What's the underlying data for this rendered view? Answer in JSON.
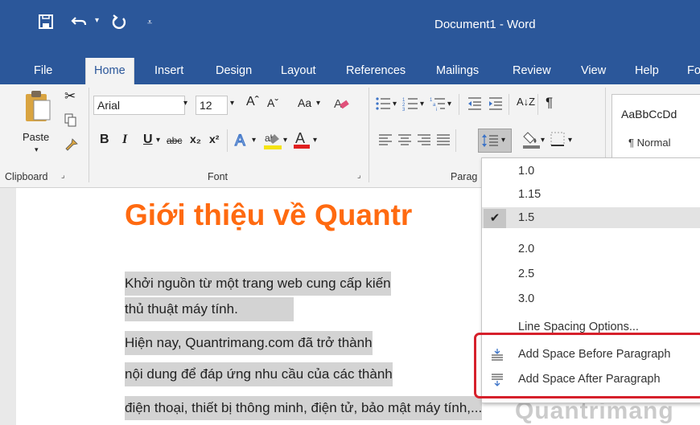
{
  "window": {
    "title": "Document1  -  Word"
  },
  "titlebar_icons": {
    "save": "save-icon",
    "undo": "undo-icon",
    "redo": "redo-icon",
    "customize": "customize-qat-icon"
  },
  "tabs": [
    {
      "label": "File"
    },
    {
      "label": "Home"
    },
    {
      "label": "Insert"
    },
    {
      "label": "Design"
    },
    {
      "label": "Layout"
    },
    {
      "label": "References"
    },
    {
      "label": "Mailings"
    },
    {
      "label": "Review"
    },
    {
      "label": "View"
    },
    {
      "label": "Help"
    },
    {
      "label": "Fo"
    }
  ],
  "ribbon": {
    "clipboard": {
      "paste_label": "Paste",
      "group_label": "Clipboard"
    },
    "font": {
      "name": "Arial",
      "size": "12",
      "group_label": "Font",
      "bold": "B",
      "italic": "I",
      "underline": "U",
      "strike": "abc",
      "subscript": "x₂",
      "superscript": "x²",
      "grow": "Aˆ",
      "shrink": "Aˇ",
      "case": "Aa",
      "font_color": "A",
      "highlight": "ab"
    },
    "paragraph": {
      "group_label": "Parag",
      "sort": "A↓Z",
      "pilcrow": "¶"
    },
    "styles": {
      "preview": "AaBbCcDd",
      "name": "¶ Normal"
    }
  },
  "document": {
    "heading": "Giới thiệu về Quantr",
    "lines": [
      "Khởi nguồn từ một trang web cung cấp kiến",
      "thủ thuật máy tính.",
      "Hiện nay, Quantrimang.com đã trở thành",
      "nội dung để đáp ứng nhu cầu của các thành",
      "điện thoại, thiết bị thông minh, điện tử, bảo mật máy tính,..."
    ]
  },
  "line_spacing_menu": {
    "options": [
      "1.0",
      "1.15",
      "1.5",
      "2.0",
      "2.5",
      "3.0"
    ],
    "selected": "1.5",
    "check_mark": "✔",
    "options_link": "Line Spacing Options...",
    "add_before": "Add Space Before Paragraph",
    "add_after": "Add Space After Paragraph"
  },
  "watermark": "Quantrimang",
  "colors": {
    "word_blue": "#2b579a",
    "heading_orange": "#ff6a10",
    "frame_red": "#d6202b"
  }
}
